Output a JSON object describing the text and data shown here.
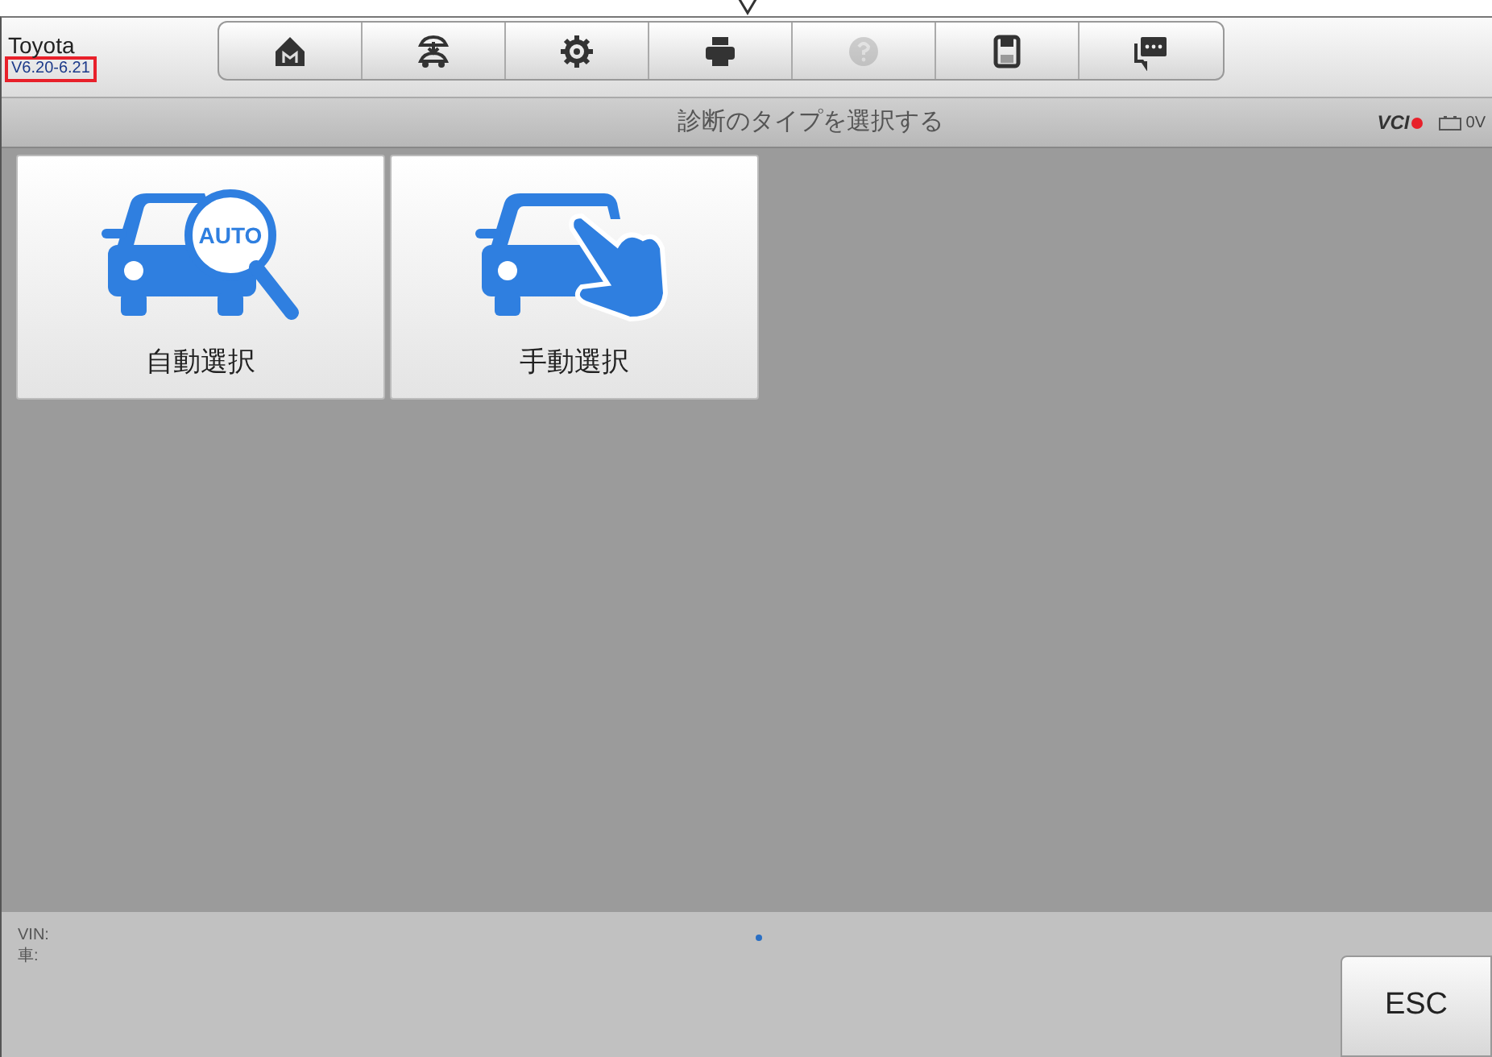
{
  "header": {
    "make": "Toyota",
    "version": "V6.20-6.21",
    "version_highlighted": true
  },
  "toolbar": [
    {
      "kind": "home",
      "disabled": false
    },
    {
      "kind": "lift",
      "disabled": false
    },
    {
      "kind": "gear",
      "disabled": false
    },
    {
      "kind": "printer",
      "disabled": false
    },
    {
      "kind": "help",
      "disabled": true
    },
    {
      "kind": "save",
      "disabled": false
    },
    {
      "kind": "chat",
      "disabled": false
    }
  ],
  "title_bar": {
    "title": "診断のタイプを選択する",
    "vci_label": "VCI",
    "vci_connected": false,
    "voltage": "0V"
  },
  "tiles": [
    {
      "kind": "auto",
      "icon_text": "AUTO",
      "label": "自動選択"
    },
    {
      "kind": "manual",
      "label": "手動選択"
    }
  ],
  "footer": {
    "vin_label": "VIN:",
    "vehicle_label": "車:",
    "esc": "ESC"
  }
}
